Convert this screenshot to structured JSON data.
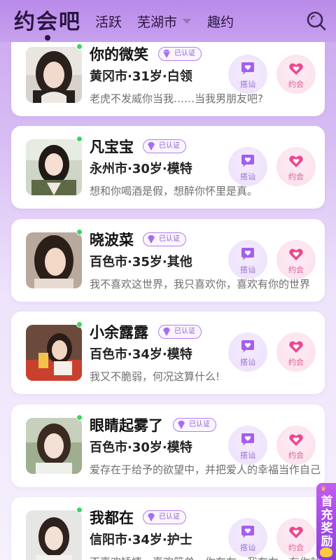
{
  "header": {
    "brand": "约会吧",
    "tabs": [
      "活跃",
      "芜湖市",
      "趣约"
    ],
    "city_dropdown_icon": "chevron-down-icon",
    "search_icon": "search-icon"
  },
  "labels": {
    "verified": "已认证",
    "chat": "搭讪",
    "date": "约会"
  },
  "colors": {
    "accent_purple": "#b57cf0",
    "chat_purple": "#9a6fd8",
    "date_pink": "#e35a93",
    "online_green": "#3ad65a"
  },
  "users": [
    {
      "name": "你的微笑",
      "meta": "黄冈市·31岁·白领",
      "bio": "老虎不发威你当我……当我男朋友吧?"
    },
    {
      "name": "凡宝宝",
      "meta": "永州市·30岁·模特",
      "bio": "想和你喝酒是假，想醉你怀里是真。"
    },
    {
      "name": "晓波菜",
      "meta": "百色市·35岁·其他",
      "bio": "我不喜欢这世界，我只喜欢你，喜欢有你的世界"
    },
    {
      "name": "小余露露",
      "meta": "百色市·34岁·模特",
      "bio": "我又不脆弱，何况这算什么!"
    },
    {
      "name": "眼睛起雾了",
      "meta": "百色市·30岁·模特",
      "bio": "爱存在于给予的欲望中，并把爱人的幸福当作自己"
    },
    {
      "name": "我都在",
      "meta": "信阳市·34岁·护士",
      "bio": "不喜欢矫情，喜欢简单，你在左，我在右，有你就好"
    }
  ],
  "promo": {
    "text": "首充奖励"
  }
}
